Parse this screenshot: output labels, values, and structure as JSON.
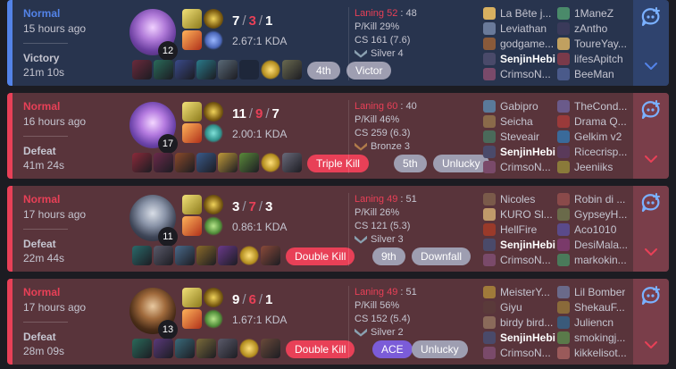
{
  "games": [
    {
      "outcome": "win",
      "queue": "Normal",
      "ago": "15 hours ago",
      "result": "Victory",
      "duration": "21m 10s",
      "champion": "champion-portrait",
      "level": "12",
      "kills": "7",
      "deaths": "3",
      "assists": "1",
      "kda_ratio": "2.67:1 KDA",
      "laning_label": "Laning 52",
      "laning_opp": "48",
      "pkill": "P/Kill 29%",
      "cs": "CS 161 (7.6)",
      "rank": "Silver 4",
      "tags": [
        "4th",
        "Victor"
      ],
      "items": [
        "#6b2a3c",
        "#2a6b5a",
        "#3a4a8a",
        "#2a7a8a",
        "#5a6a78",
        "empty",
        "ward",
        "#6a6a50"
      ],
      "blue_team": [
        "La Bête j...",
        "Leviathan",
        "godgame...",
        "SenjinHebi",
        "CrimsoN..."
      ],
      "red_team": [
        "1ManeZ",
        "zAntho",
        "ToureYay...",
        "lifesApitch",
        "BeeMan"
      ],
      "blue_colors": [
        "#d8b060",
        "#6a7a9a",
        "#8a5a3a",
        "#4a4a6a",
        "#7a4a6a"
      ],
      "red_colors": [
        "#4a8a6a",
        "#3a3a5a",
        "#c0a060",
        "#7a3a4a",
        "#4a5a8a"
      ]
    },
    {
      "outcome": "loss",
      "queue": "Normal",
      "ago": "16 hours ago",
      "result": "Defeat",
      "duration": "41m 24s",
      "level": "17",
      "kills": "11",
      "deaths": "9",
      "assists": "7",
      "kda_ratio": "2.00:1 KDA",
      "laning_label": "Laning 60",
      "laning_opp": "40",
      "pkill": "P/Kill 46%",
      "cs": "CS 259 (6.3)",
      "rank": "Bronze 3",
      "tags": [
        "Triple Kill",
        "5th",
        "Unlucky"
      ],
      "items": [
        "#8a2a3a",
        "#6a2a4a",
        "#8a4a2a",
        "#3a5a8a",
        "#c09a3a",
        "#5a8a3a",
        "ward",
        "#6a6a7a"
      ],
      "blue_team": [
        "Gabipro",
        "Seicha",
        "Steveair",
        "SenjinHebi",
        "CrimsoN..."
      ],
      "red_team": [
        "TheCond...",
        "Drama Q...",
        "Gelkim v2",
        "Ricecrisp...",
        "Jeeniiks"
      ],
      "blue_colors": [
        "#5a7a9a",
        "#8a6a4a",
        "#4a6a5a",
        "#4a4a6a",
        "#7a4a6a"
      ],
      "red_colors": [
        "#6a5a8a",
        "#9a3a3a",
        "#3a6a9a",
        "#5a3a5a",
        "#8a7a3a"
      ]
    },
    {
      "outcome": "loss",
      "queue": "Normal",
      "ago": "17 hours ago",
      "result": "Defeat",
      "duration": "22m 44s",
      "level": "11",
      "kills": "3",
      "deaths": "7",
      "assists": "3",
      "kda_ratio": "0.86:1 KDA",
      "laning_label": "Laning 49",
      "laning_opp": "51",
      "pkill": "P/Kill 26%",
      "cs": "CS 121 (5.3)",
      "rank": "Silver 3",
      "tags": [
        "Double Kill",
        "9th",
        "Downfall"
      ],
      "items": [
        "#2a6a6a",
        "#5a5a6a",
        "#4a6a8a",
        "#8a6a2a",
        "#6a3a8a",
        "ward",
        "#8a4a3a"
      ],
      "blue_team": [
        "Nicoles",
        "KURO Sl...",
        "HellFire",
        "SenjinHebi",
        "CrimsoN..."
      ],
      "red_team": [
        "Robin di ...",
        "GypseyH...",
        "Aco1010",
        "DesiMala...",
        "markokin..."
      ],
      "blue_colors": [
        "#7a5a4a",
        "#c09a6a",
        "#9a3a2a",
        "#4a4a6a",
        "#7a4a6a"
      ],
      "red_colors": [
        "#8a4a4a",
        "#6a6a4a",
        "#5a4a8a",
        "#7a3a6a",
        "#4a7a5a"
      ]
    },
    {
      "outcome": "loss",
      "queue": "Normal",
      "ago": "17 hours ago",
      "result": "Defeat",
      "duration": "28m 09s",
      "level": "13",
      "kills": "9",
      "deaths": "6",
      "assists": "1",
      "kda_ratio": "1.67:1 KDA",
      "laning_label": "Laning 49",
      "laning_opp": "51",
      "pkill": "P/Kill 56%",
      "cs": "CS 152 (5.4)",
      "rank": "Silver 2",
      "tags": [
        "Double Kill",
        "ACE",
        "Unlucky"
      ],
      "items": [
        "#2a6a5a",
        "#5a3a7a",
        "#3a6a7a",
        "#7a6a3a",
        "#5a5a6a",
        "ward",
        "#6a4a3a"
      ],
      "blue_team": [
        "MeisterY...",
        "Giyu",
        "birdy bird...",
        "SenjinHebi",
        "CrimsoN..."
      ],
      "red_team": [
        "Lil Bomber",
        "ShekauF...",
        "Juliencn",
        "smokingj...",
        "kikkelisot..."
      ],
      "blue_colors": [
        "#a07a3a",
        "#5a3a3a",
        "#8a6a5a",
        "#4a4a6a",
        "#7a4a6a"
      ],
      "red_colors": [
        "#6a6a8a",
        "#8a6a3a",
        "#3a5a7a",
        "#5a7a4a",
        "#9a5a5a"
      ]
    }
  ],
  "colors": {
    "win_accent": "#5383e8",
    "loss_accent": "#e84057"
  }
}
